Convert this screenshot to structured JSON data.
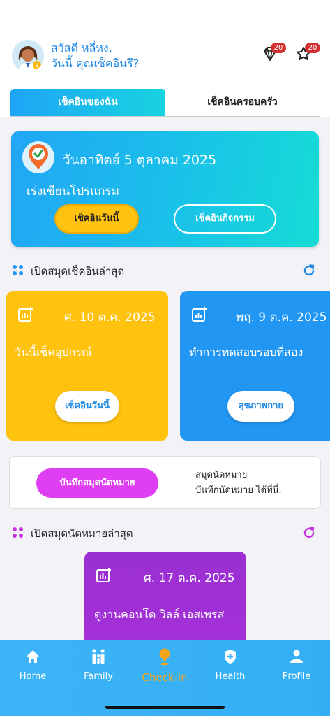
{
  "header": {
    "greeting_line1": "สวัสดี หลี่หง,",
    "greeting_line2": "วันนี้ คุณเช็คอินรึ?",
    "diamond_count": "20",
    "star_count": "20"
  },
  "tabs": [
    {
      "label": "เช็คอินของฉัน",
      "active": true
    },
    {
      "label": "เช็คอินครอบครัว",
      "active": false
    }
  ],
  "hero": {
    "date": "วันอาทิตย์ 5 ตุลาคม 2025",
    "subtitle": "เร่งเขียนโปรแกรม",
    "checkin_today_label": "เช็คอินวันนี้",
    "checkin_activity_label": "เช็คอินกิจกรรม"
  },
  "latest_checkin": {
    "title": "เปิดสมุดเช็คอินล่าสุด",
    "cards": [
      {
        "date": "ศ. 10 ต.ค. 2025",
        "text": "วันนี้เช็คอุปกรณ์",
        "button": "เช็คอินวันนี้",
        "color": "#ffc20e"
      },
      {
        "date": "พฤ. 9 ต.ค. 2025",
        "text": "ทำการทดสอบรอบที่สอง",
        "button": "สุขภาพกาย",
        "color": "#2196f3"
      }
    ]
  },
  "appointment": {
    "button_label": "บันทึกสมุดนัดหมาย",
    "line1": "สมุดนัดหมาย",
    "line2": "บันทึกนัดหมาย ได้ที่นี่."
  },
  "latest_appointment": {
    "title": "เปิดสมุดนัดหมายล่าสุด",
    "card": {
      "date": "ศ. 17 ต.ค. 2025",
      "text": "ดูงานคอนโด วิลล์ เอสเพรส"
    }
  },
  "nav": {
    "home": "Home",
    "family": "Family",
    "checkin": "Check-in",
    "health": "Health",
    "profile": "Profile"
  },
  "colors": {
    "primary_blue": "#1e88e5",
    "accent_yellow": "#ffc20e",
    "accent_purple": "#df3ef2",
    "nav_blue": "#3db4f7",
    "nav_active": "#f4a51c"
  }
}
